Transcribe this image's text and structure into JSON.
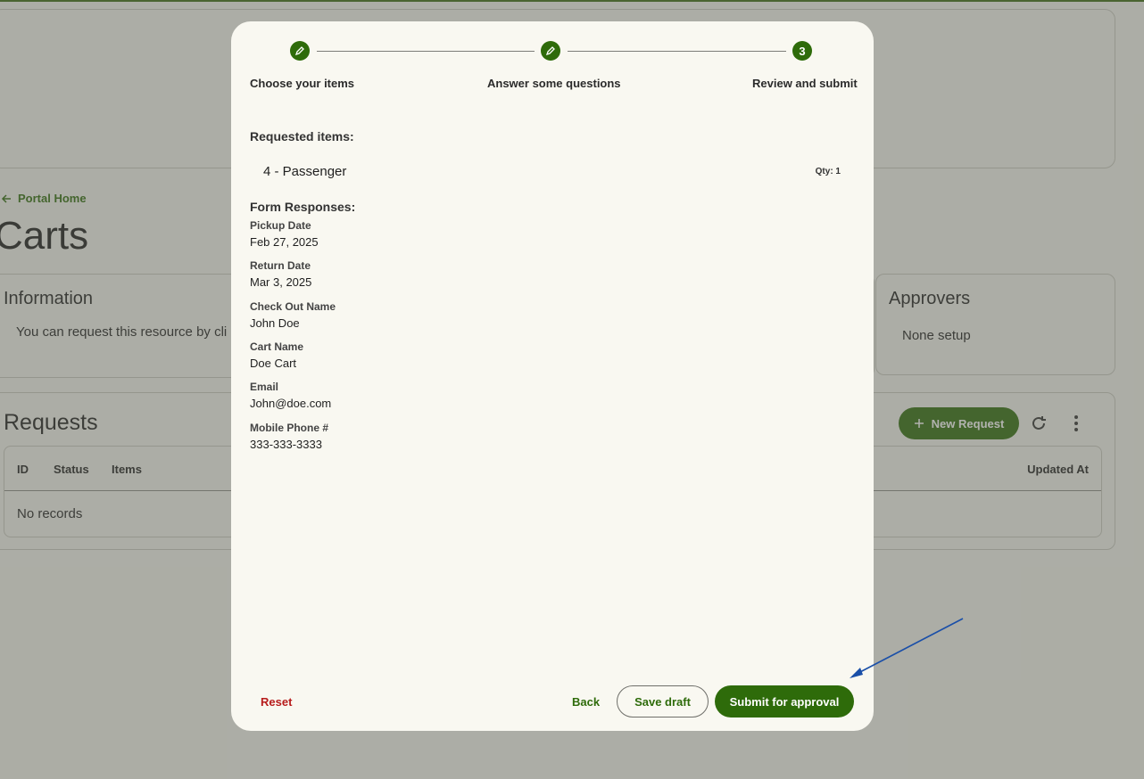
{
  "background": {
    "back_link": "Portal Home",
    "page_title": "Carts",
    "information": {
      "title": "Information",
      "text": "You can request this resource by cli"
    },
    "approvers": {
      "title": "Approvers",
      "text": "None setup"
    },
    "requests": {
      "title": "Requests",
      "new_request_label": "New Request",
      "columns": [
        "ID",
        "Status",
        "Items",
        "Updated At"
      ],
      "empty_text": "No records"
    }
  },
  "dialog": {
    "steps": [
      {
        "label": "Choose your items",
        "marker": "edit-icon"
      },
      {
        "label": "Answer some questions",
        "marker": "edit-icon"
      },
      {
        "label": "Review and submit",
        "marker": "3"
      }
    ],
    "requested_items_title": "Requested items:",
    "items": [
      {
        "name": "4 - Passenger",
        "qty": "Qty: 1"
      }
    ],
    "form_responses_title": "Form Responses:",
    "responses": [
      {
        "label": "Pickup Date",
        "value": "Feb 27, 2025"
      },
      {
        "label": "Return Date",
        "value": "Mar 3, 2025"
      },
      {
        "label": "Check Out Name",
        "value": "John Doe"
      },
      {
        "label": "Cart Name",
        "value": "Doe Cart"
      },
      {
        "label": "Email",
        "value": "John@doe.com"
      },
      {
        "label": "Mobile Phone #",
        "value": "333-333-3333"
      }
    ],
    "buttons": {
      "reset": "Reset",
      "back": "Back",
      "save_draft": "Save draft",
      "submit": "Submit for approval"
    }
  },
  "colors": {
    "primary": "#2e6b0a",
    "danger": "#b71c1c",
    "annotation": "#1a4fa8"
  }
}
